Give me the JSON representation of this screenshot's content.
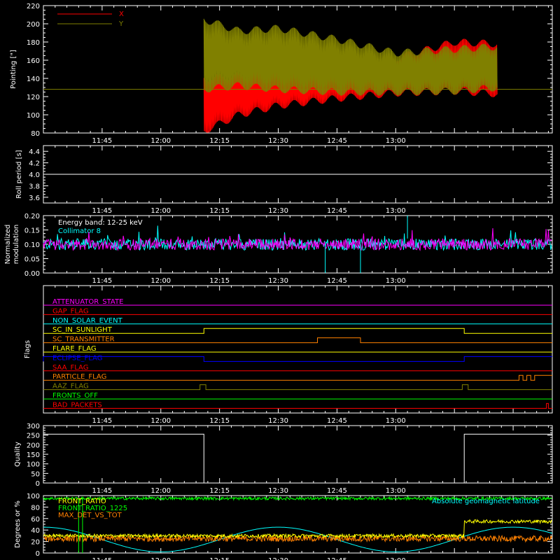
{
  "colors": {
    "x": "#ff0000",
    "y": "#808000",
    "white": "#ffffff",
    "coll": "#00ffff",
    "mag": "#ff00ff",
    "green": "#00ff00",
    "yellow": "#ffff00",
    "orange": "#ff8000",
    "cyan": "#00ffff"
  },
  "time_ticks": [
    "11:45",
    "12:00",
    "12:15",
    "12:30",
    "12:45",
    "13:00"
  ],
  "chart_data": [
    {
      "type": "line",
      "ylabel": "Pointing [\"]",
      "ylim": [
        80,
        220
      ],
      "yticks": [
        "80",
        "100",
        "120",
        "140",
        "160",
        "180",
        "200",
        "220"
      ],
      "legend": [
        "X",
        "Y"
      ],
      "legend_position": "top-left",
      "series": [
        {
          "name": "X",
          "envelope_time_min": [
            41,
            50,
            60,
            75,
            90,
            105,
            116
          ],
          "upper": [
            140,
            143,
            148,
            150,
            162,
            180,
            178
          ],
          "lower": [
            82,
            100,
            110,
            118,
            124,
            126,
            123
          ]
        },
        {
          "name": "Y",
          "envelope_time_min": [
            41,
            50,
            60,
            75,
            90,
            105,
            116
          ],
          "upper": [
            205,
            192,
            195,
            183,
            168,
            172,
            175
          ],
          "lower": [
            128,
            132,
            128,
            125,
            125,
            126,
            130
          ]
        }
      ],
      "reference_line": 128
    },
    {
      "type": "line",
      "ylabel": "Roll period [s]",
      "ylim": [
        3.5,
        4.5
      ],
      "yticks": [
        "3.6",
        "3.8",
        "4.0",
        "4.2",
        "4.4"
      ],
      "series": [
        {
          "name": "",
          "constant": 4.0
        }
      ]
    },
    {
      "type": "line",
      "ylabel": "Normalized\nmodulation",
      "ylim": [
        0,
        0.2
      ],
      "yticks": [
        "0.00",
        "0.05",
        "0.10",
        "0.15",
        "0.20"
      ],
      "annotations": [
        "Energy band: 12-25 keV",
        "Collimator 8"
      ],
      "series": [
        {
          "name": "Collimator 8",
          "mean": 0.1
        }
      ]
    },
    {
      "type": "line",
      "ylabel": "Flags",
      "flags": [
        {
          "name": "ATTENUATOR_STATE",
          "color": "#ff00ff",
          "on_intervals": []
        },
        {
          "name": "GAP_FLAG",
          "color": "#ff0000",
          "on_intervals": []
        },
        {
          "name": "NON_SOLAR_EVENT",
          "color": "#00ffff",
          "on_intervals": []
        },
        {
          "name": "SC_IN_SUNLIGHT",
          "color": "#ffff00",
          "on_intervals": [
            [
              41,
              107.5
            ]
          ]
        },
        {
          "name": "SC_TRANSMITTER",
          "color": "#ff8000",
          "on_intervals": [
            [
              70,
              81
            ]
          ]
        },
        {
          "name": "FLARE_FLAG",
          "color": "#ffff00",
          "on_intervals": []
        },
        {
          "name": "ECLIPSE_FLAG",
          "color": "#0000ff",
          "on_intervals": [
            [
              0,
              41
            ],
            [
              107.5,
              130
            ]
          ]
        },
        {
          "name": "SAA_FLAG",
          "color": "#ff0000",
          "on_intervals": []
        },
        {
          "name": "PARTICLE_FLAG",
          "color": "#ff8000",
          "on_intervals": [
            [
              121.5,
              122.5
            ],
            [
              123.5,
              124.5
            ],
            [
              125.5,
              130
            ]
          ]
        },
        {
          "name": "AAZ_FLAG",
          "color": "#808000",
          "on_intervals": [
            [
              40,
              41.5
            ],
            [
              107,
              108.5
            ]
          ]
        },
        {
          "name": "FRONTS_OFF",
          "color": "#00ff00",
          "on_intervals": []
        },
        {
          "name": "BAD_PACKETS",
          "color": "#ff0000",
          "on_intervals": [
            [
              128.5,
              129
            ]
          ]
        }
      ]
    },
    {
      "type": "line",
      "ylabel": "Quality",
      "ylim": [
        0,
        300
      ],
      "yticks": [
        "0",
        "50",
        "100",
        "150",
        "200",
        "250",
        "300"
      ],
      "series": [
        {
          "name": "",
          "x": [
            0,
            41,
            41,
            107.5,
            107.5,
            130
          ],
          "y": [
            255,
            255,
            0,
            0,
            255,
            255
          ]
        }
      ]
    },
    {
      "type": "line",
      "ylabel": "Degrees or %",
      "ylim": [
        0,
        100
      ],
      "yticks": [
        "0",
        "20",
        "40",
        "60",
        "80",
        "100"
      ],
      "series": [
        {
          "name": "FRONT_RATIO",
          "color": "#ffff00",
          "mean_before": 30,
          "mean_after": 55
        },
        {
          "name": "FRONT_RATIO_1225",
          "color": "#00ff00",
          "mean": 95
        },
        {
          "name": "MAX_DET_VS_TOT",
          "color": "#ff8000",
          "mean": 25
        },
        {
          "name": "Absolute geomagnetic latitude",
          "color": "#00ffff",
          "minima_time_min": [
            30,
            90
          ],
          "maxima_time_min": [
            0,
            60,
            120
          ],
          "min": 2,
          "max": 45
        }
      ]
    }
  ],
  "labels": {
    "panel1_ylabel": "Pointing [\"]",
    "panel2_ylabel": "Roll period [s]",
    "panel3_ylabel_1": "Normalized",
    "panel3_ylabel_2": "modulation",
    "panel3_ann1": "Energy band: 12-25 keV",
    "panel3_ann2": "Collimator 8",
    "panel4_ylabel": "Flags",
    "panel5_ylabel": "Quality",
    "panel6_ylabel": "Degrees or %",
    "legend_x": "X",
    "legend_y": "Y",
    "p6_leg1": "FRONT_RATIO",
    "p6_leg2": "FRONT_RATIO_1225",
    "p6_leg3": "MAX_DET_VS_TOT",
    "p6_leg4": "Absolute geomagnetic latitude"
  }
}
